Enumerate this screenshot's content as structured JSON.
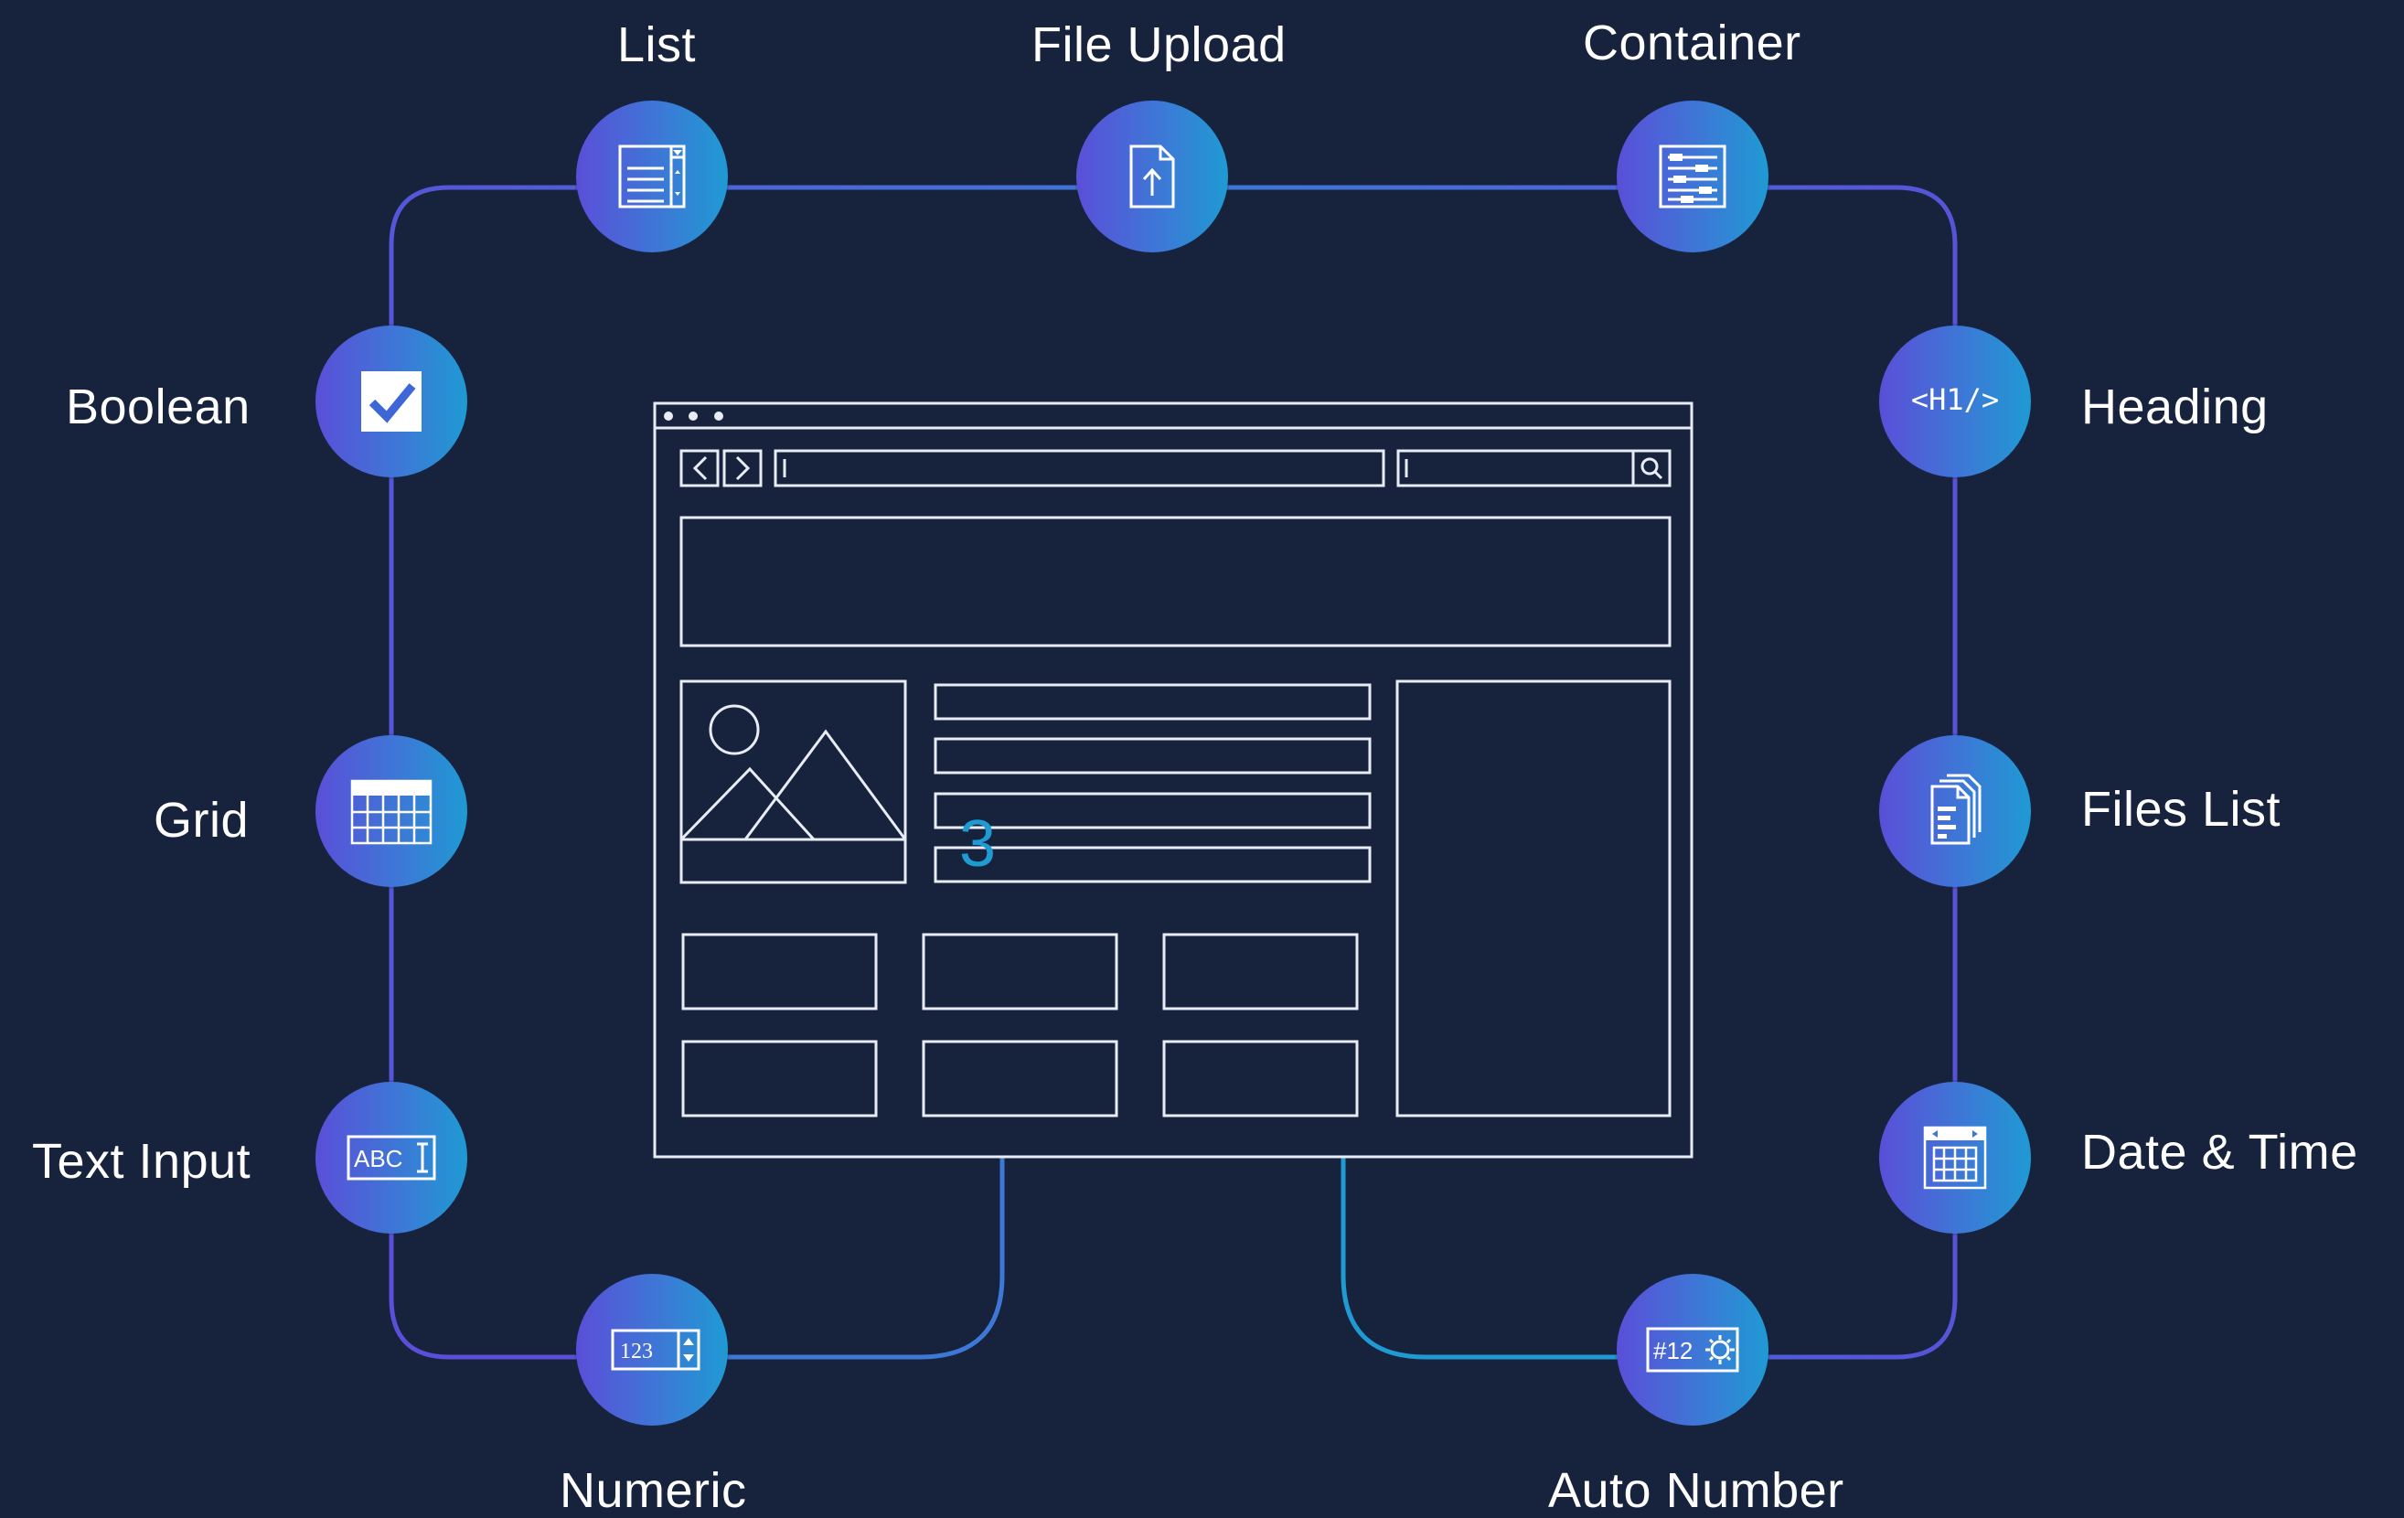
{
  "colors": {
    "background": "#17223d",
    "line_start": "#5a4fd8",
    "line_end": "#1f9ad3",
    "wireframe": "#e8ecf5",
    "accent_number": "#1f9ad3"
  },
  "nodes": {
    "list": {
      "label": "List",
      "icon": "list-icon"
    },
    "file_upload": {
      "label": "File Upload",
      "icon": "file-upload-icon"
    },
    "container": {
      "label": "Container",
      "icon": "container-icon"
    },
    "boolean": {
      "label": "Boolean",
      "icon": "checkbox-icon"
    },
    "heading": {
      "label": "Heading",
      "icon": "heading-icon",
      "icon_text": "<H1/>"
    },
    "grid": {
      "label": "Grid",
      "icon": "grid-icon"
    },
    "files_list": {
      "label": "Files List",
      "icon": "files-list-icon"
    },
    "text_input": {
      "label": "Text Input",
      "icon": "text-input-icon",
      "icon_text": "ABC"
    },
    "date_time": {
      "label": "Date & Time",
      "icon": "calendar-icon"
    },
    "numeric": {
      "label": "Numeric",
      "icon": "numeric-stepper-icon",
      "icon_text": "123"
    },
    "auto_number": {
      "label": "Auto Number",
      "icon": "auto-number-icon",
      "icon_text": "#12"
    }
  },
  "wireframe": {
    "center_mark": "3"
  }
}
